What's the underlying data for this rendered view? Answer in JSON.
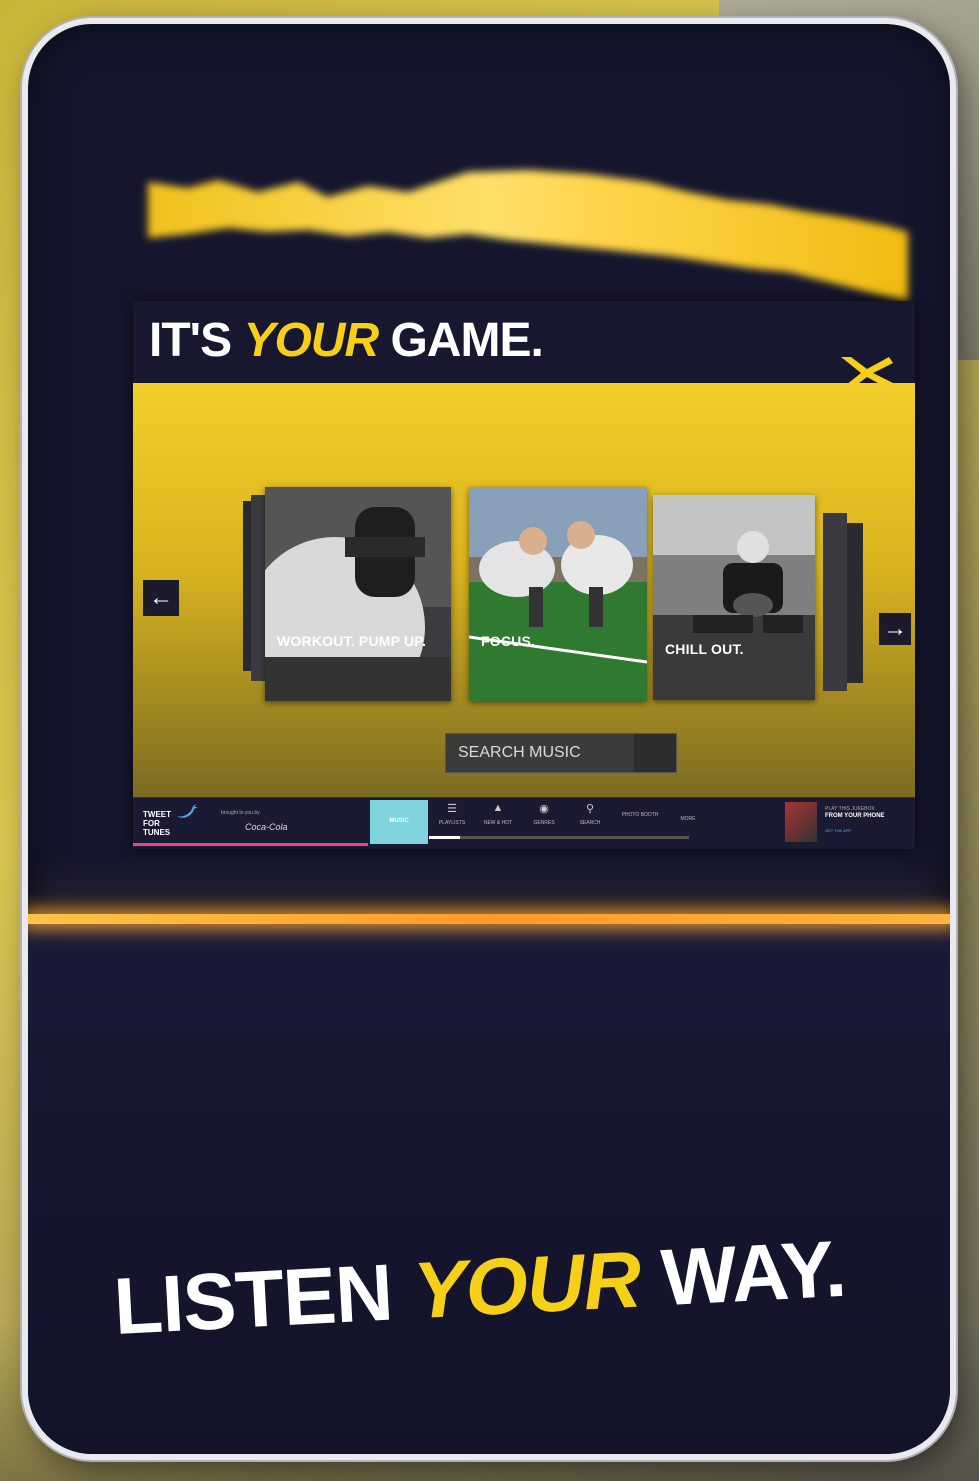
{
  "screen": {
    "headline": {
      "prefix": "IT'S",
      "accent": "YOUR",
      "suffix": "GAME."
    },
    "brand_logo_icon": "x-logo",
    "nav": {
      "prev_icon": "arrow-left-icon",
      "next_icon": "arrow-right-icon"
    },
    "playlists": [
      {
        "label": "WORKOUT. PUMP UP.",
        "image": "dumbbell-photo"
      },
      {
        "label": "FOCUS.",
        "image": "football-linemen-photo"
      },
      {
        "label": "CHILL OUT.",
        "image": "player-with-football-photo"
      }
    ],
    "search": {
      "placeholder": "SEARCH MUSIC"
    },
    "bottom_bar": {
      "tweet_for_tunes": [
        "TWEET",
        "FOR",
        "TUNES"
      ],
      "brought_to_you_by": "brought to you by",
      "sponsor": "Coca-Cola",
      "tabs": [
        {
          "label": "MUSIC",
          "active": true
        },
        {
          "label": "PLAYLISTS",
          "icon": "playlist-icon"
        },
        {
          "label": "NEW & HOT",
          "icon": "flame-icon"
        },
        {
          "label": "GENRES",
          "icon": "genre-icon"
        },
        {
          "label": "SEARCH",
          "icon": "search-icon"
        },
        {
          "label": "PHOTO BOOTH"
        },
        {
          "label": "MORE"
        }
      ],
      "playback_progress": 0.12,
      "promo": {
        "line1": "PLAY THIS JUKEBOX",
        "line2": "FROM YOUR PHONE",
        "line3": "GET THE APP"
      }
    }
  },
  "tagline": {
    "prefix": "LISTEN",
    "accent": "YOUR",
    "suffix": "WAY."
  },
  "colors": {
    "accent": "#f6cf1a",
    "kiosk": "#15162e",
    "glow": "#ffb340"
  }
}
